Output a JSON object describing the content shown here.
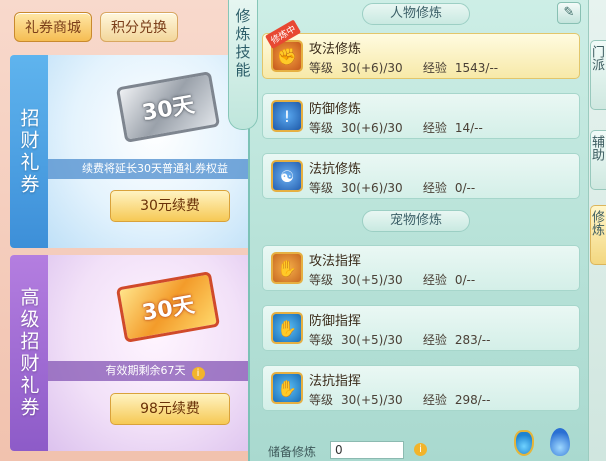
{
  "shop": {
    "tabs": [
      {
        "label": "礼券商城",
        "active": true
      },
      {
        "label": "积分兑换",
        "active": false
      }
    ],
    "vouchers": [
      {
        "side_label": "招财礼券",
        "ticket_text": "30天",
        "note": "续费将延长30天普通礼券权益",
        "button": "30元续费"
      },
      {
        "side_label": "高级招财礼券",
        "ticket_text": "30天",
        "note": "有效期剩余67天",
        "info_icon": "i",
        "button": "98元续费"
      }
    ]
  },
  "cultivation": {
    "tab_label": "修炼技能",
    "edit_icon": "✎",
    "player_section": "人物修炼",
    "pet_section": "宠物修炼",
    "training_badge": "修炼中",
    "level_label": "等级",
    "exp_label": "经验",
    "player_skills": [
      {
        "name": "攻法修炼",
        "level": "30(+6)/30",
        "exp": "1543/--",
        "icon": "attack-icon",
        "glyph": "✊",
        "active": true
      },
      {
        "name": "防御修炼",
        "level": "30(+6)/30",
        "exp": "14/--",
        "icon": "shield-icon",
        "glyph": "!",
        "active": false
      },
      {
        "name": "法抗修炼",
        "level": "30(+6)/30",
        "exp": "0/--",
        "icon": "yin-yang-icon",
        "glyph": "☯",
        "active": false
      }
    ],
    "pet_skills": [
      {
        "name": "攻法指挥",
        "level": "30(+5)/30",
        "exp": "0/--",
        "icon": "paw-attack-icon",
        "glyph": "✋",
        "active": false
      },
      {
        "name": "防御指挥",
        "level": "30(+5)/30",
        "exp": "283/--",
        "icon": "paw-shield-icon",
        "glyph": "✋",
        "active": false
      },
      {
        "name": "法抗指挥",
        "level": "30(+5)/30",
        "exp": "298/--",
        "icon": "paw-resist-icon",
        "glyph": "✋",
        "active": false
      }
    ],
    "reserve_label": "储备修炼",
    "reserve_value": "0",
    "reserve_info": "i"
  },
  "edge_tabs": [
    "门派",
    "辅助",
    "修炼"
  ]
}
